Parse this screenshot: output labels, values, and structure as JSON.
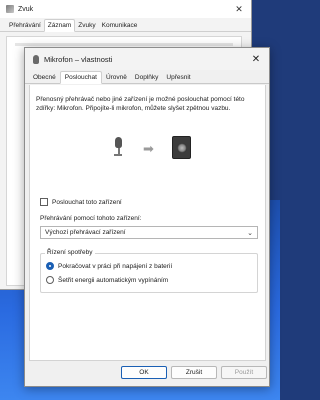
{
  "back_window": {
    "title": "Zvuk",
    "tabs": [
      "Přehrávání",
      "Záznam",
      "Zvuky",
      "Komunikace"
    ],
    "active_tab": 1
  },
  "dialog": {
    "title": "Mikrofon – vlastnosti",
    "close_glyph": "✕",
    "tabs": [
      "Obecné",
      "Poslouchat",
      "Úrovně",
      "Doplňky",
      "Upřesnit"
    ],
    "active_tab": 1,
    "description": "Přenosný přehrávač nebo jiné zařízení je možné poslouchat pomocí této zdířky: Mikrofon. Připojíte-li mikrofon, můžete slyšet zpětnou vazbu.",
    "listen_checkbox": {
      "label": "Poslouchat toto zařízení",
      "checked": false
    },
    "playback_label": "Přehrávání pomocí tohoto zařízení:",
    "playback_select": {
      "value": "Výchozí přehrávací zařízení"
    },
    "power": {
      "legend": "Řízení spotřeby",
      "options": [
        {
          "label": "Pokračovat v práci při napájení z baterií",
          "checked": true
        },
        {
          "label": "Šetřit energii automatickým vypínáním",
          "checked": false
        }
      ]
    },
    "buttons": {
      "ok": "OK",
      "cancel": "Zrušit",
      "apply": "Použít"
    }
  },
  "icons": {
    "mic": "microphone-icon",
    "arrow": "arrow-right-icon",
    "speaker": "speaker-icon"
  }
}
